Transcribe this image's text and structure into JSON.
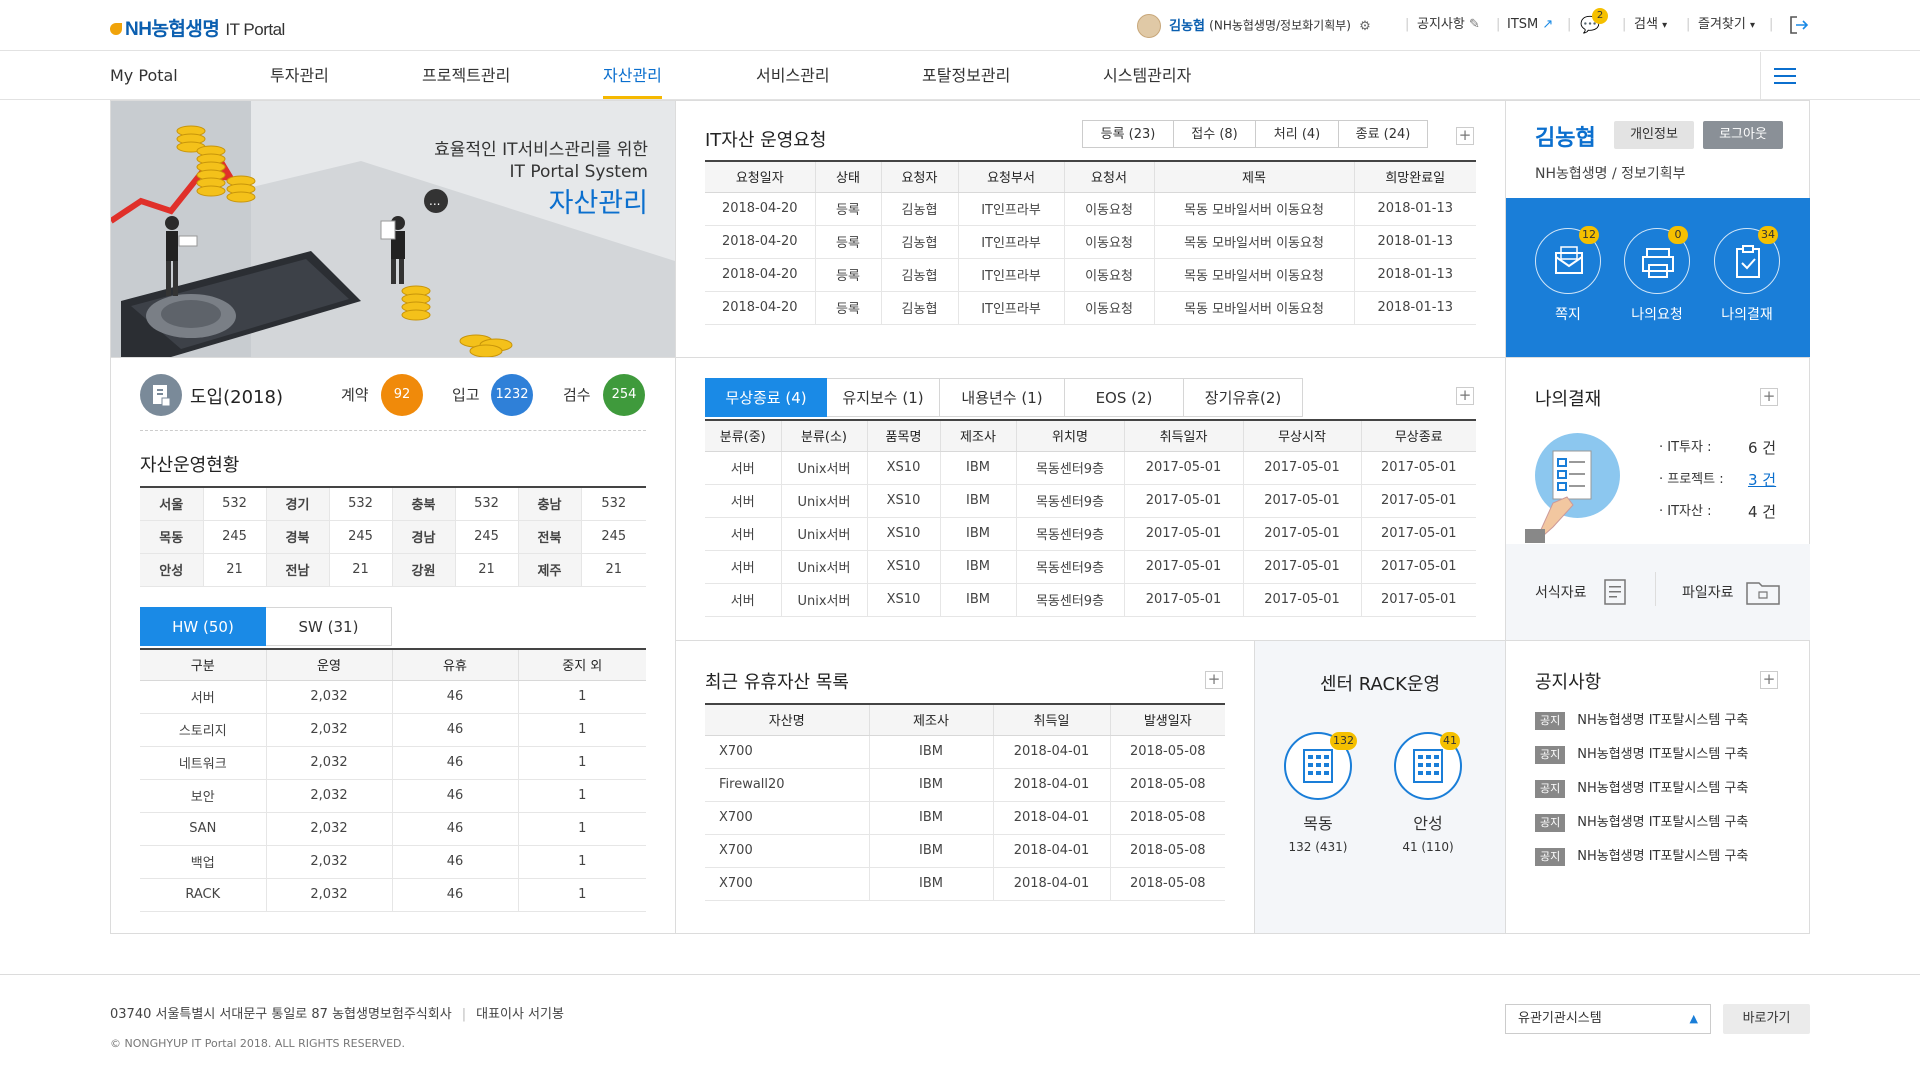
{
  "header": {
    "logo": "NH농협생명",
    "portal": "IT Portal",
    "user_name": "김농협",
    "user_dept": "(NH농협생명/정보화기획부)",
    "notice": "공지사항",
    "itsm": "ITSM",
    "message_count": "2",
    "search": "검색",
    "favorites": "즐겨찾기"
  },
  "gnb": [
    "My Potal",
    "투자관리",
    "프로젝트관리",
    "자산관리",
    "서비스관리",
    "포탈정보관리",
    "시스템관리자"
  ],
  "banner": {
    "line1": "효율적인 IT서비스관리를 위한",
    "line2": "IT Portal System",
    "title": "자산관리"
  },
  "it_request": {
    "title": "IT자산 운영요청",
    "steps": [
      "등록 (23)",
      "접수 (8)",
      "처리 (4)",
      "종료 (24)"
    ],
    "columns": [
      "요청일자",
      "상태",
      "요청자",
      "요청부서",
      "요청서",
      "제목",
      "희망완료일"
    ],
    "rows": [
      [
        "2018-04-20",
        "등록",
        "김농협",
        "IT인프라부",
        "이동요청",
        "목동 모바일서버 이동요청",
        "2018-01-13"
      ],
      [
        "2018-04-20",
        "등록",
        "김농협",
        "IT인프라부",
        "이동요청",
        "목동 모바일서버 이동요청",
        "2018-01-13"
      ],
      [
        "2018-04-20",
        "등록",
        "김농협",
        "IT인프라부",
        "이동요청",
        "목동 모바일서버 이동요청",
        "2018-01-13"
      ],
      [
        "2018-04-20",
        "등록",
        "김농협",
        "IT인프라부",
        "이동요청",
        "목동 모바일서버 이동요청",
        "2018-01-13"
      ]
    ]
  },
  "profile": {
    "name": "김농협",
    "info_btn": "개인정보",
    "logout_btn": "로그아웃",
    "dept": "NH농협생명 / 정보기획부",
    "icons": [
      {
        "label": "쪽지",
        "count": "12"
      },
      {
        "label": "나의요청",
        "count": "0"
      },
      {
        "label": "나의결재",
        "count": "34"
      }
    ]
  },
  "intro": {
    "title": "도입(2018)",
    "stats": [
      {
        "label": "계약",
        "value": "92",
        "color": "#f08a0a"
      },
      {
        "label": "입고",
        "value": "1232",
        "color": "#2f80d8"
      },
      {
        "label": "검수",
        "value": "254",
        "color": "#3f9a3c"
      }
    ]
  },
  "asset_status": {
    "title": "자산운영현황",
    "rows": [
      [
        [
          "서울",
          "532"
        ],
        [
          "경기",
          "532"
        ],
        [
          "충북",
          "532"
        ],
        [
          "충남",
          "532"
        ]
      ],
      [
        [
          "목동",
          "245"
        ],
        [
          "경북",
          "245"
        ],
        [
          "경남",
          "245"
        ],
        [
          "전북",
          "245"
        ]
      ],
      [
        [
          "안성",
          "21"
        ],
        [
          "전남",
          "21"
        ],
        [
          "강원",
          "21"
        ],
        [
          "제주",
          "21"
        ]
      ]
    ]
  },
  "hwsw": {
    "tabs": [
      "HW (50)",
      "SW (31)"
    ],
    "columns": [
      "구분",
      "운영",
      "유휴",
      "중지 외"
    ],
    "rows": [
      [
        "서버",
        "2,032",
        "46",
        "1"
      ],
      [
        "스토리지",
        "2,032",
        "46",
        "1"
      ],
      [
        "네트워크",
        "2,032",
        "46",
        "1"
      ],
      [
        "보안",
        "2,032",
        "46",
        "1"
      ],
      [
        "SAN",
        "2,032",
        "46",
        "1"
      ],
      [
        "백업",
        "2,032",
        "46",
        "1"
      ],
      [
        "RACK",
        "2,032",
        "46",
        "1"
      ]
    ]
  },
  "warranty": {
    "tabs": [
      "무상종료 (4)",
      "유지보수 (1)",
      "내용년수 (1)",
      "EOS (2)",
      "장기유휴(2)"
    ],
    "columns": [
      "분류(중)",
      "분류(소)",
      "품목명",
      "제조사",
      "위치명",
      "취득일자",
      "무상시작",
      "무상종료"
    ],
    "rows": [
      [
        "서버",
        "Unix서버",
        "XS10",
        "IBM",
        "목동센터9층",
        "2017-05-01",
        "2017-05-01",
        "2017-05-01"
      ],
      [
        "서버",
        "Unix서버",
        "XS10",
        "IBM",
        "목동센터9층",
        "2017-05-01",
        "2017-05-01",
        "2017-05-01"
      ],
      [
        "서버",
        "Unix서버",
        "XS10",
        "IBM",
        "목동센터9층",
        "2017-05-01",
        "2017-05-01",
        "2017-05-01"
      ],
      [
        "서버",
        "Unix서버",
        "XS10",
        "IBM",
        "목동센터9층",
        "2017-05-01",
        "2017-05-01",
        "2017-05-01"
      ],
      [
        "서버",
        "Unix서버",
        "XS10",
        "IBM",
        "목동센터9층",
        "2017-05-01",
        "2017-05-01",
        "2017-05-01"
      ]
    ]
  },
  "approval": {
    "title": "나의결재",
    "items": [
      {
        "label": "IT투자 :",
        "value": "6 건"
      },
      {
        "label": "프로젝트 :",
        "value": "3 건"
      },
      {
        "label": "IT자산 :",
        "value": "4 건"
      }
    ],
    "form_docs": "서식자료",
    "file_docs": "파일자료"
  },
  "idle": {
    "title": "최근 유휴자산 목록",
    "columns": [
      "자산명",
      "제조사",
      "취득일",
      "발생일자"
    ],
    "rows": [
      [
        "X700",
        "IBM",
        "2018-04-01",
        "2018-05-08"
      ],
      [
        "Firewall20",
        "IBM",
        "2018-04-01",
        "2018-05-08"
      ],
      [
        "X700",
        "IBM",
        "2018-04-01",
        "2018-05-08"
      ],
      [
        "X700",
        "IBM",
        "2018-04-01",
        "2018-05-08"
      ],
      [
        "X700",
        "IBM",
        "2018-04-01",
        "2018-05-08"
      ]
    ]
  },
  "rack": {
    "title": "센터 RACK운영",
    "items": [
      {
        "name": "목동",
        "sub": "132 (431)",
        "badge": "132"
      },
      {
        "name": "안성",
        "sub": "41 (110)",
        "badge": "41"
      }
    ]
  },
  "notice": {
    "title": "공지사항",
    "tag": "공지",
    "items": [
      "NH농협생명 IT포탈시스템 구축",
      "NH농협생명 IT포탈시스템 구축",
      "NH농협생명 IT포탈시스템 구축",
      "NH농협생명 IT포탈시스템 구축",
      "NH농협생명 IT포탈시스템 구축"
    ]
  },
  "footer": {
    "address": "03740  서울특별시 서대문구 통일로 87 농협생명보험주식회사",
    "ceo": "대표이사 서기봉",
    "copyright": "© NONGHYUP IT Portal 2018.  ALL RIGHTS RESERVED.",
    "select": "유관기관시스템",
    "go": "바로가기"
  }
}
